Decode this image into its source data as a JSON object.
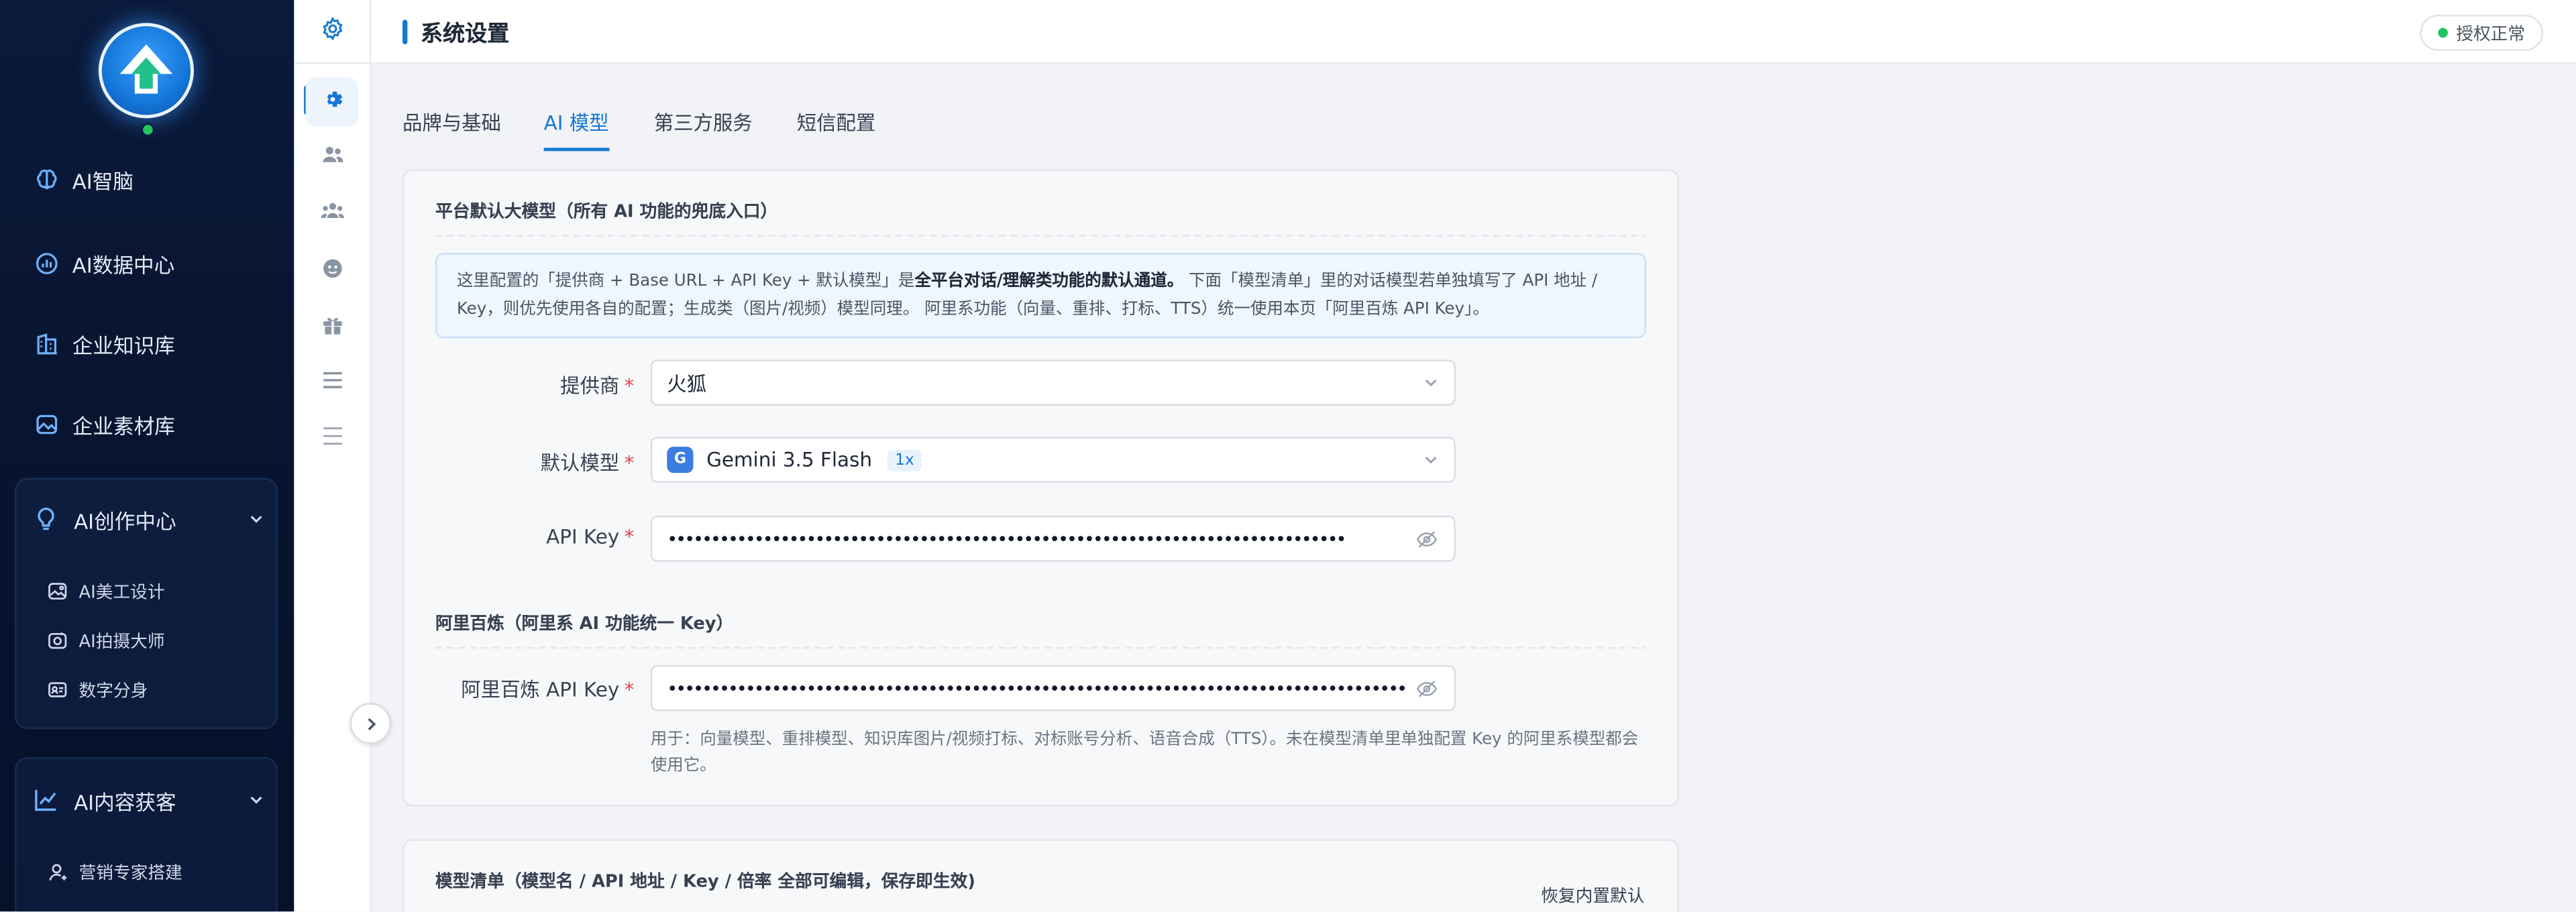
{
  "sidebar": {
    "logo_name": "app-logo",
    "items": [
      {
        "label": "AI智脑",
        "icon": "brain-icon"
      },
      {
        "label": "AI数据中心",
        "icon": "data-center-icon"
      },
      {
        "label": "企业知识库",
        "icon": "knowledge-base-icon"
      },
      {
        "label": "企业素材库",
        "icon": "image-library-icon"
      }
    ],
    "groups": [
      {
        "label": "AI创作中心",
        "icon": "bulb-icon",
        "children": [
          {
            "label": "AI美工设计",
            "icon": "design-icon"
          },
          {
            "label": "AI拍摄大师",
            "icon": "camera-icon"
          },
          {
            "label": "数字分身",
            "icon": "avatar-card-icon"
          }
        ]
      },
      {
        "label": "AI内容获客",
        "icon": "trend-icon",
        "children": [
          {
            "label": "营销专家搭建",
            "icon": "user-icon"
          }
        ]
      }
    ]
  },
  "rail": {
    "icons": [
      "settings-icon",
      "users-icon",
      "team-icon",
      "bot-icon",
      "gift-icon",
      "menu-icon",
      "list-icon"
    ]
  },
  "header": {
    "title": "系统设置",
    "license_status": "授权正常"
  },
  "tabs": [
    {
      "label": "品牌与基础",
      "active": false
    },
    {
      "label": "AI 模型",
      "active": true
    },
    {
      "label": "第三方服务",
      "active": false
    },
    {
      "label": "短信配置",
      "active": false
    }
  ],
  "platform_section": {
    "title": "平台默认大模型（所有 AI 功能的兜底入口）",
    "info_pre": "这里配置的「提供商 + Base URL + API Key + 默认模型」是",
    "info_bold": "全平台对话/理解类功能的默认通道。",
    "info_post": " 下面「模型清单」里的对话模型若单独填写了 API 地址 / Key，则优先使用各自的配置；生成类（图片/视频）模型同理。 阿里系功能（向量、重排、打标、TTS）统一使用本页「阿里百炼 API Key」。",
    "provider_label": "提供商",
    "provider_value": "火狐",
    "model_label": "默认模型",
    "model_badge": "G",
    "model_value": "Gemini 3.5 Flash",
    "model_ratio": "1x",
    "apikey_label": "API Key",
    "apikey_value": "••••••••••••••••••••••••••••••••••••••••••••••••••••••••••••••••••••••••••••••"
  },
  "aliyun_section": {
    "title": "阿里百炼（阿里系 AI 功能统一 Key）",
    "apikey_label": "阿里百炼 API Key",
    "apikey_value": "••••••••••••••••••••••••••••••••••••••••••••••••••••••••••••••••••••••••••••••••••••••••••••••••••••••",
    "help": "用于：向量模型、重排模型、知识库图片/视频打标、对标账号分析、语音合成（TTS）。未在模型清单里单独配置 Key 的阿里系模型都会使用它。"
  },
  "models_section": {
    "title": "模型清单（模型名 / API 地址 / Key / 倍率 全部可编辑，保存即生效)",
    "restore_label": "恢复内置默认"
  },
  "colors": {
    "accent": "#1677d2",
    "sidebar_bg": "#0a1a3b",
    "required": "#e5484d",
    "status_ok": "#22c55e"
  }
}
